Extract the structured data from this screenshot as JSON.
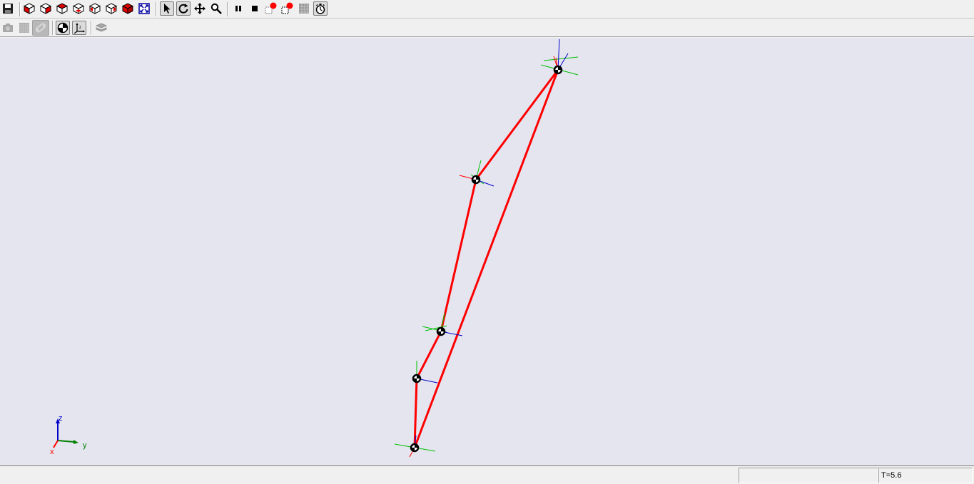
{
  "toolbar_main": {
    "buttons": [
      {
        "name": "save-button",
        "icon": "floppy-disk-icon"
      },
      {
        "name": "view-front-button",
        "icon": "cube-front-icon"
      },
      {
        "name": "view-back-button",
        "icon": "cube-back-icon"
      },
      {
        "name": "view-top-button",
        "icon": "cube-top-icon"
      },
      {
        "name": "view-bottom-button",
        "icon": "cube-bottom-icon"
      },
      {
        "name": "view-left-button",
        "icon": "cube-left-icon"
      },
      {
        "name": "view-right-button",
        "icon": "cube-right-icon"
      },
      {
        "name": "view-iso-button",
        "icon": "cube-iso-icon"
      },
      {
        "name": "zoom-fit-button",
        "icon": "zoom-fit-icon"
      },
      {
        "name": "select-tool-button",
        "icon": "cursor-arrow-icon"
      },
      {
        "name": "rotate-tool-button",
        "icon": "rotate-icon"
      },
      {
        "name": "pan-tool-button",
        "icon": "move-arrows-icon"
      },
      {
        "name": "zoom-tool-button",
        "icon": "magnifier-icon"
      },
      {
        "name": "pause-button",
        "icon": "pause-icon"
      },
      {
        "name": "stop-button",
        "icon": "stop-icon"
      },
      {
        "name": "record-frame-button",
        "icon": "record-frame-icon"
      },
      {
        "name": "record-sequence-button",
        "icon": "record-sequence-icon"
      },
      {
        "name": "grid-disabled-button",
        "icon": "grid-icon"
      },
      {
        "name": "timer-button",
        "icon": "stopwatch-icon"
      }
    ]
  },
  "toolbar_secondary": {
    "buttons": [
      {
        "name": "camera-button",
        "icon": "camera-icon"
      },
      {
        "name": "mesh-button",
        "icon": "mesh-icon"
      },
      {
        "name": "link-button",
        "icon": "link-icon"
      },
      {
        "name": "center-of-mass-toggle",
        "icon": "center-of-mass-icon"
      },
      {
        "name": "show-frames-toggle",
        "icon": "axes-frame-icon"
      },
      {
        "name": "layers-button",
        "icon": "layers-icon"
      }
    ]
  },
  "viewport": {
    "background_color": "#e5e5f0",
    "link_color": "#ff0000",
    "triad_labels": {
      "x": "x",
      "y": "y",
      "z": "z"
    },
    "x_axis_color": "#ff0000",
    "y_axis_color": "#009000",
    "z_axis_color": "#0000c8"
  },
  "status": {
    "message": "",
    "time": "T=5.6"
  }
}
